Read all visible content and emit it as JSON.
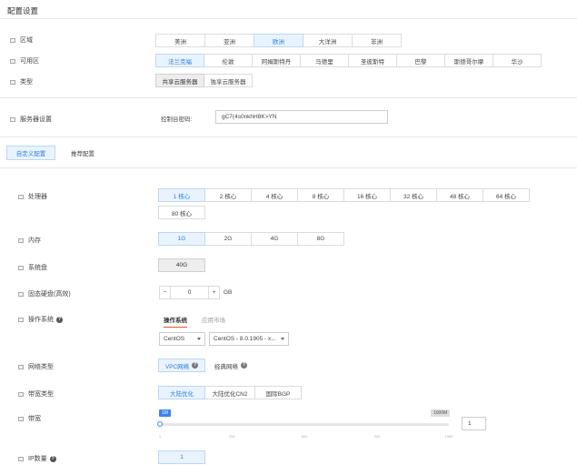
{
  "page_title": "配置设置",
  "region": {
    "label": "区域",
    "options": [
      "美洲",
      "亚洲",
      "欧洲",
      "大洋洲",
      "非洲"
    ],
    "selected": 2
  },
  "zone": {
    "label": "可用区",
    "options": [
      "法兰克福",
      "伦敦",
      "阿姆斯特丹",
      "马德里",
      "圣彼斯特",
      "巴黎",
      "斯德哥尔摩",
      "华沙"
    ],
    "selected": 0
  },
  "type": {
    "label": "类型",
    "options": [
      "共享云服务器",
      "独享云服务器"
    ],
    "selected": 0
  },
  "server_settings": {
    "label": "服务器设置",
    "password_label": "控制台密码:",
    "password_value": "gC7(4s0nkhH8K>YN"
  },
  "config_tabs": {
    "items": [
      "自定义配置",
      "推荐配置"
    ],
    "selected": 0
  },
  "cpu": {
    "label": "处理器",
    "options": [
      "1 核心",
      "2 核心",
      "4 核心",
      "8 核心",
      "16 核心",
      "32 核心",
      "48 核心",
      "64 核心",
      "80 核心"
    ],
    "selected": 0
  },
  "memory": {
    "label": "内存",
    "options": [
      "1G",
      "2G",
      "4G",
      "8G"
    ],
    "selected": 0
  },
  "system_disk": {
    "label": "系统盘",
    "value": "40G"
  },
  "ssd": {
    "label": "固态硬盘(高效)",
    "minus": "−",
    "plus": "+",
    "value": "0",
    "unit": "GB"
  },
  "os": {
    "label": "操作系统",
    "tabs": [
      "操作系统",
      "应用市场"
    ],
    "selected_tab": 0,
    "distro": "CentOS",
    "version": "CentOS - 8.0.1905 - x..."
  },
  "network_type": {
    "label": "网络类型",
    "options": [
      "VPC网络",
      "经典网络"
    ],
    "selected": 0
  },
  "bandwidth_type": {
    "label": "带宽类型",
    "options": [
      "大陆优化",
      "大陆优化CN2",
      "国际BGP"
    ],
    "selected": 0
  },
  "bandwidth": {
    "label": "带宽",
    "min_badge": "1M",
    "max_badge": "1000M",
    "value": "1",
    "level": 0.0,
    "ticks": [
      "1",
      "251",
      "501",
      "750",
      "1000"
    ]
  },
  "ip_count": {
    "label": "IP数量",
    "value": "1"
  },
  "colors": {
    "accent": "#2f7fd8",
    "selected_bg": "#e9f3fd",
    "tab_underline": "#e05a2b"
  }
}
